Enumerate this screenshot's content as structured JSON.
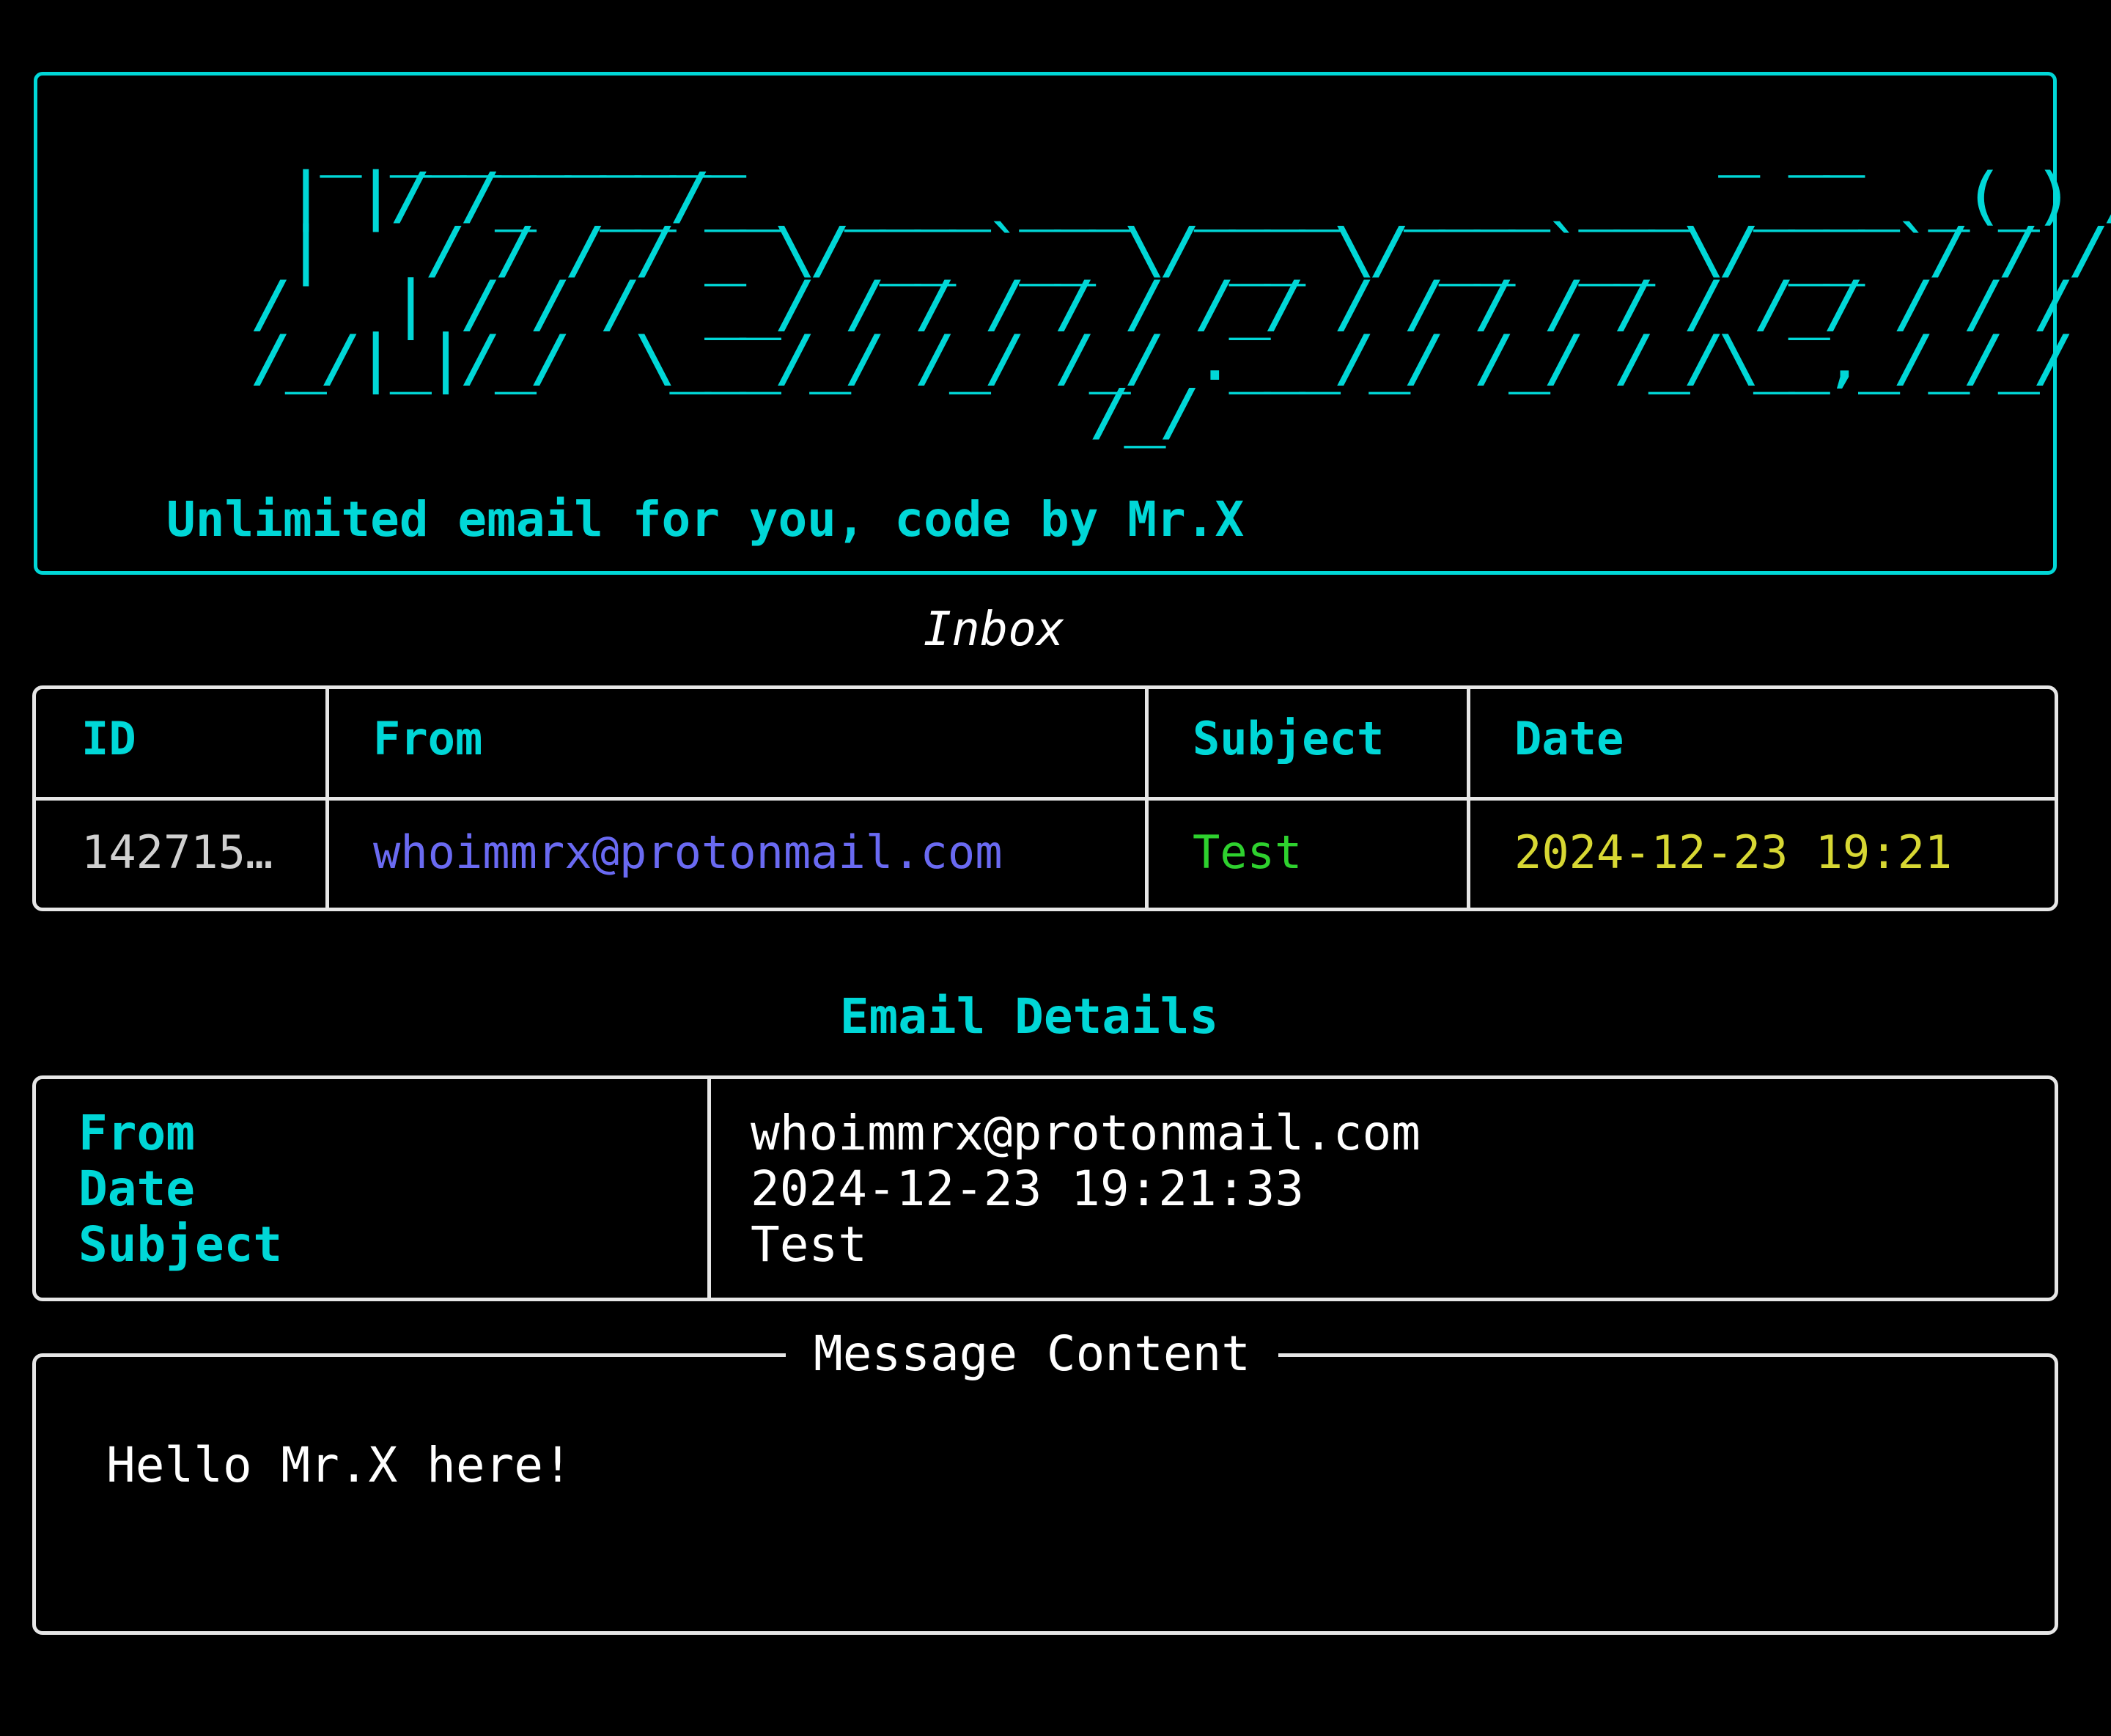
{
  "banner": {
    "ascii_art": "  _ __________                            _ __\n | |/ /_  __/__  ____ ___  ____  ____ ___  ____ _(_) /\n |   / / / / _ \\/ __ `__ \\/ __ \\/ __ `__ \\/ __ `/ / /\n/   | / / /  __/ / / / / / /_/ / / / / / / /_/ / / /\n/_/|_|/_/  \\___/_/ /_/ /_/ .___/_/ /_/ /_/\\__,_/_/_/\n                        /_/",
    "tagline": "Unlimited email for you, code by Mr.X"
  },
  "inbox": {
    "title": "Inbox",
    "columns": [
      "ID",
      "From",
      "Subject",
      "Date"
    ],
    "rows": [
      {
        "id": "142715…",
        "from": "whoimmrx@protonmail.com",
        "subject": "Test",
        "date": "2024-12-23 19:21"
      }
    ]
  },
  "details": {
    "title": "Email Details",
    "labels": [
      "From",
      "Date",
      "Subject"
    ],
    "values": [
      "whoimmrx@protonmail.com",
      "2024-12-23 19:21:33",
      "Test"
    ]
  },
  "message": {
    "title": "Message Content",
    "body": "Hello Mr.X here!"
  },
  "colors": {
    "accent": "#00d7d7",
    "from": "#6a6af2",
    "subject": "#2ed12e",
    "date": "#d7d733",
    "border": "#e6e6e6",
    "background": "#000000"
  }
}
